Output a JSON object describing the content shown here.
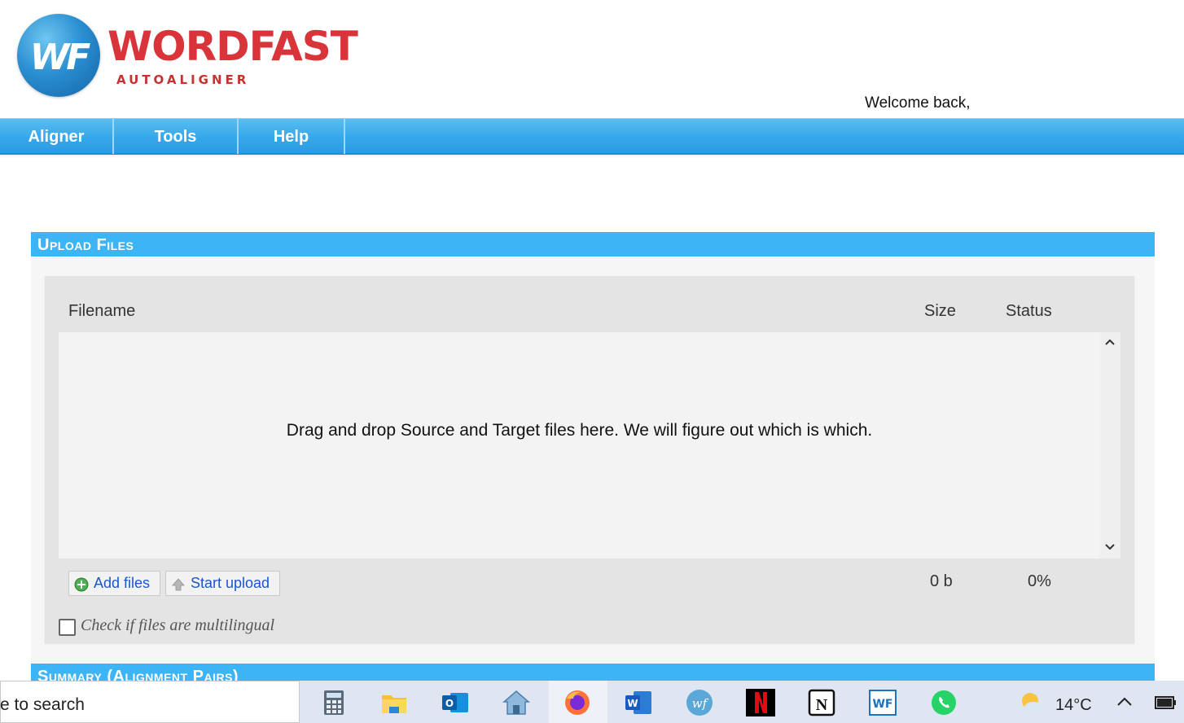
{
  "header": {
    "logo_initials": "WF",
    "logo_word": "WORDFAST",
    "logo_subtitle": "AUTOALIGNER",
    "welcome_text": "Welcome back,"
  },
  "nav": {
    "items": [
      {
        "label": "Aligner"
      },
      {
        "label": "Tools"
      },
      {
        "label": "Help"
      }
    ]
  },
  "upload": {
    "section_title": "Upload Files",
    "columns": {
      "filename": "Filename",
      "size": "Size",
      "status": "Status"
    },
    "dropzone_message": "Drag and drop Source and Target files here. We will figure out which is which.",
    "add_files_label": "Add files",
    "start_upload_label": "Start upload",
    "total_size": "0 b",
    "total_status": "0%",
    "multilingual_label": "Check if files are multilingual",
    "multilingual_checked": false
  },
  "summary": {
    "section_title": "Summary (Alignment Pairs)"
  },
  "taskbar": {
    "search_text": "e to search",
    "apps": [
      "calculator-icon",
      "file-explorer-icon",
      "outlook-icon",
      "home-icon",
      "firefox-icon",
      "word-icon",
      "wordfast-wf-icon",
      "netflix-icon",
      "notion-icon",
      "wordfast-icon",
      "whatsapp-icon"
    ],
    "weather_temp": "14°C"
  },
  "colors": {
    "nav_blue": "#35a8ea",
    "section_blue": "#3cb4f5",
    "logo_red": "#d8343a",
    "link_blue": "#1a56c9"
  }
}
